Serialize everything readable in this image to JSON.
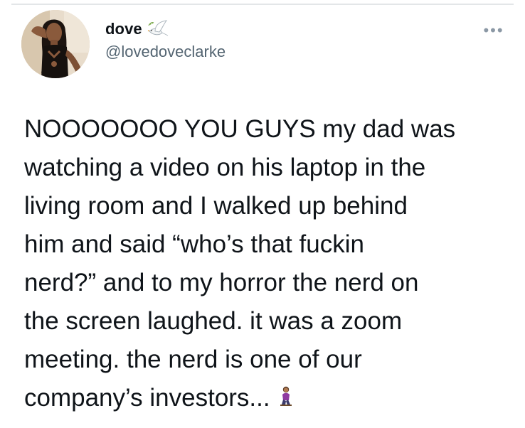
{
  "tweet": {
    "display_name": "dove",
    "handle": "@lovedoveclarke",
    "more_label": "•••",
    "text": "NOOOOOOO YOU GUYS my dad was\nwatching a video on his laptop in the\nliving room and I walked up behind\nhim and said “who’s that fuckin\nnerd?” and to my horror the nerd on\nthe screen laughed. it was a zoom\nmeeting. the nerd is one of our\ncompany’s investors...",
    "name_emoji": "dove-icon",
    "trailing_emoji": "person-kneeling-icon"
  }
}
